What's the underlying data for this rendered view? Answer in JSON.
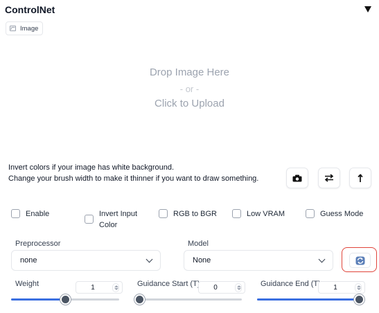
{
  "panel": {
    "title": "ControlNet",
    "toggle_icon": "triangle-down-icon"
  },
  "image_tab": {
    "label": "Image",
    "icon": "image-icon"
  },
  "drop_zone": {
    "line1": "Drop Image Here",
    "or": "- or -",
    "line2": "Click to Upload"
  },
  "hints": {
    "line1": "Invert colors if your image has white background.",
    "line2": "Change your brush width to make it thinner if you want to draw something."
  },
  "tool_buttons": [
    {
      "name": "camera-button",
      "icon": "camera-icon"
    },
    {
      "name": "swap-button",
      "icon": "swap-arrows-icon"
    },
    {
      "name": "upload-arrow-button",
      "icon": "arrow-up-icon"
    }
  ],
  "checkboxes": [
    {
      "label": "Enable",
      "checked": false
    },
    {
      "label": "Invert Input Color",
      "line1": "Invert Input",
      "line2": "Color",
      "checked": false
    },
    {
      "label": "RGB to BGR",
      "checked": false
    },
    {
      "label": "Low VRAM",
      "checked": false
    },
    {
      "label": "Guess Mode",
      "checked": false
    }
  ],
  "preprocessor": {
    "label": "Preprocessor",
    "value": "none"
  },
  "model": {
    "label": "Model",
    "value": "None"
  },
  "refresh": {
    "icon": "refresh-icon",
    "highlight_color": "#e0443a"
  },
  "sliders": {
    "weight": {
      "label": "Weight",
      "value": "1",
      "fraction": 0.5
    },
    "guidance_start": {
      "label": "Guidance Start (T)",
      "value": "0",
      "fraction": 0.0
    },
    "guidance_end": {
      "label": "Guidance End (T)",
      "value": "1",
      "fraction": 1.0
    }
  },
  "colors": {
    "accent": "#3b6fe0",
    "thumb": "#4b5563"
  }
}
